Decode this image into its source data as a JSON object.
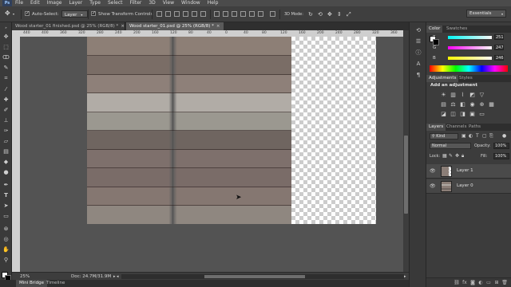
{
  "menubar": {
    "logo": "Ps",
    "items": [
      "File",
      "Edit",
      "Image",
      "Layer",
      "Type",
      "Select",
      "Filter",
      "3D",
      "View",
      "Window",
      "Help"
    ]
  },
  "options_bar": {
    "auto_select_label": "Auto-Select:",
    "auto_select_value": "Layer",
    "show_transform_label": "Show Transform Controls",
    "workspace": "Essentials"
  },
  "doc_tabs": [
    {
      "label": "Wood starter_01 finished.psd @ 25% (RGB/8) *",
      "close": "×"
    },
    {
      "label": "Wood starter_01.psd @ 25% (RGB/8) *",
      "close": "×"
    }
  ],
  "ruler_ticks": [
    "440",
    "400",
    "360",
    "320",
    "280",
    "240",
    "200",
    "160",
    "120",
    "80",
    "40",
    "0",
    "40",
    "80",
    "120",
    "160",
    "200",
    "240",
    "280",
    "320",
    "360"
  ],
  "status": {
    "zoom": "25%",
    "doc_size": "Doc: 24.7M/31.9M"
  },
  "bottom_tabs": [
    "Mini Bridge",
    "Timeline"
  ],
  "color_panel": {
    "tabs": [
      "Color",
      "Swatches"
    ],
    "sliders": [
      {
        "label": "R",
        "value": "251"
      },
      {
        "label": "G",
        "value": "247"
      },
      {
        "label": "B",
        "value": "246"
      }
    ]
  },
  "adjustments_panel": {
    "tabs": [
      "Adjustments",
      "Styles"
    ],
    "heading": "Add an adjustment"
  },
  "layers_panel": {
    "tabs": [
      "Layers",
      "Channels",
      "Paths"
    ],
    "filter_kind": "Kind",
    "blend_mode": "Normal",
    "opacity_label": "Opacity:",
    "opacity_value": "100%",
    "lock_label": "Lock:",
    "fill_label": "Fill:",
    "fill_value": "100%",
    "layers": [
      {
        "name": "Layer 1"
      },
      {
        "name": "Layer 0"
      }
    ]
  },
  "colors": {
    "foreground": "#ffffff",
    "background": "#000000",
    "wood_planks": [
      "#8d7f76",
      "#7a6d66",
      "#8e8079",
      "#b1aca6",
      "#9b9890",
      "#6f6560",
      "#7e706c",
      "#7a6c68",
      "#857771",
      "#8f8780"
    ]
  }
}
